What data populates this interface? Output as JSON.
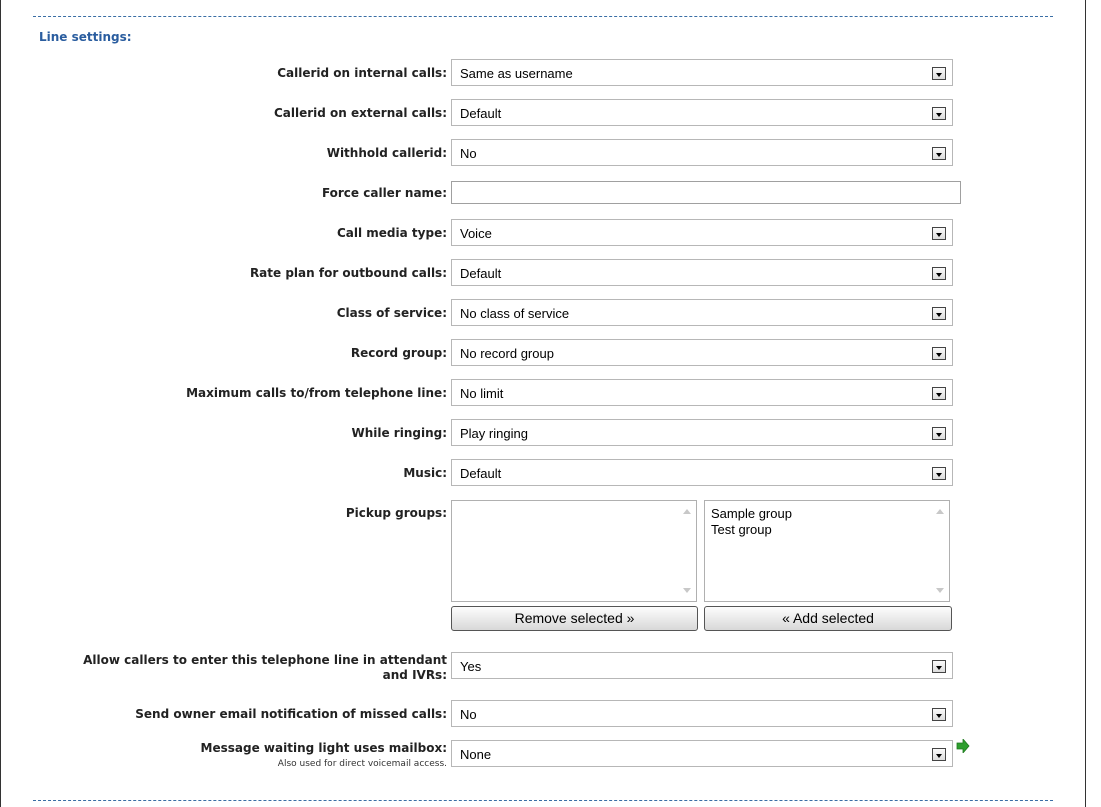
{
  "section": {
    "title": "Line settings:"
  },
  "fields": {
    "callerid_internal": {
      "label": "Callerid on internal calls:",
      "value": "Same as username"
    },
    "callerid_external": {
      "label": "Callerid on external calls:",
      "value": "Default"
    },
    "withhold_callerid": {
      "label": "Withhold callerid:",
      "value": "No"
    },
    "force_caller_name": {
      "label": "Force caller name:",
      "value": ""
    },
    "call_media_type": {
      "label": "Call media type:",
      "value": "Voice"
    },
    "rate_plan": {
      "label": "Rate plan for outbound calls:",
      "value": "Default"
    },
    "class_of_service": {
      "label": "Class of service:",
      "value": "No class of service"
    },
    "record_group": {
      "label": "Record group:",
      "value": "No record group"
    },
    "max_calls": {
      "label": "Maximum calls to/from telephone line:",
      "value": "No limit"
    },
    "while_ringing": {
      "label": "While ringing:",
      "value": "Play ringing"
    },
    "music": {
      "label": "Music:",
      "value": "Default"
    },
    "pickup_groups": {
      "label": "Pickup groups:",
      "selected": [],
      "available": [
        "Sample group",
        "Test group"
      ],
      "remove_label": "Remove selected »",
      "add_label": "« Add selected"
    },
    "allow_attendant": {
      "label_line1": "Allow callers to enter this telephone line in attendant",
      "label_line2": "and IVRs:",
      "value": "Yes"
    },
    "missed_calls_email": {
      "label": "Send owner email notification of missed calls:",
      "value": "No"
    },
    "mwi_mailbox": {
      "label": "Message waiting light uses mailbox:",
      "sublabel": "Also used for direct voicemail access.",
      "value": "None"
    }
  },
  "colors": {
    "section_title": "#2a5d9f",
    "go_arrow": "#2e9e2e"
  },
  "icons": {
    "select_arrow": "chevron-down-icon",
    "go": "green-arrow-right-icon"
  }
}
